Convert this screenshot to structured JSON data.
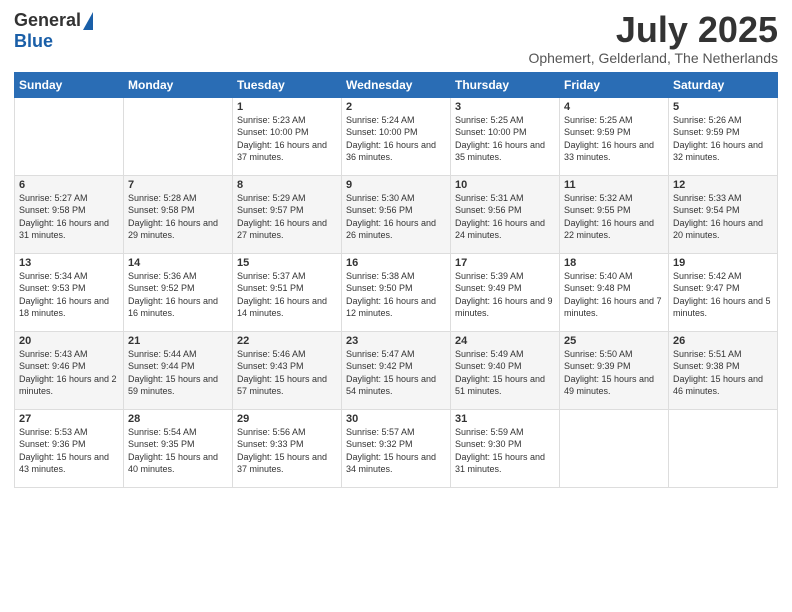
{
  "header": {
    "logo_general": "General",
    "logo_blue": "Blue",
    "month": "July 2025",
    "location": "Ophemert, Gelderland, The Netherlands"
  },
  "weekdays": [
    "Sunday",
    "Monday",
    "Tuesday",
    "Wednesday",
    "Thursday",
    "Friday",
    "Saturday"
  ],
  "weeks": [
    [
      {
        "day": "",
        "sunrise": "",
        "sunset": "",
        "daylight": ""
      },
      {
        "day": "",
        "sunrise": "",
        "sunset": "",
        "daylight": ""
      },
      {
        "day": "1",
        "sunrise": "Sunrise: 5:23 AM",
        "sunset": "Sunset: 10:00 PM",
        "daylight": "Daylight: 16 hours and 37 minutes."
      },
      {
        "day": "2",
        "sunrise": "Sunrise: 5:24 AM",
        "sunset": "Sunset: 10:00 PM",
        "daylight": "Daylight: 16 hours and 36 minutes."
      },
      {
        "day": "3",
        "sunrise": "Sunrise: 5:25 AM",
        "sunset": "Sunset: 10:00 PM",
        "daylight": "Daylight: 16 hours and 35 minutes."
      },
      {
        "day": "4",
        "sunrise": "Sunrise: 5:25 AM",
        "sunset": "Sunset: 9:59 PM",
        "daylight": "Daylight: 16 hours and 33 minutes."
      },
      {
        "day": "5",
        "sunrise": "Sunrise: 5:26 AM",
        "sunset": "Sunset: 9:59 PM",
        "daylight": "Daylight: 16 hours and 32 minutes."
      }
    ],
    [
      {
        "day": "6",
        "sunrise": "Sunrise: 5:27 AM",
        "sunset": "Sunset: 9:58 PM",
        "daylight": "Daylight: 16 hours and 31 minutes."
      },
      {
        "day": "7",
        "sunrise": "Sunrise: 5:28 AM",
        "sunset": "Sunset: 9:58 PM",
        "daylight": "Daylight: 16 hours and 29 minutes."
      },
      {
        "day": "8",
        "sunrise": "Sunrise: 5:29 AM",
        "sunset": "Sunset: 9:57 PM",
        "daylight": "Daylight: 16 hours and 27 minutes."
      },
      {
        "day": "9",
        "sunrise": "Sunrise: 5:30 AM",
        "sunset": "Sunset: 9:56 PM",
        "daylight": "Daylight: 16 hours and 26 minutes."
      },
      {
        "day": "10",
        "sunrise": "Sunrise: 5:31 AM",
        "sunset": "Sunset: 9:56 PM",
        "daylight": "Daylight: 16 hours and 24 minutes."
      },
      {
        "day": "11",
        "sunrise": "Sunrise: 5:32 AM",
        "sunset": "Sunset: 9:55 PM",
        "daylight": "Daylight: 16 hours and 22 minutes."
      },
      {
        "day": "12",
        "sunrise": "Sunrise: 5:33 AM",
        "sunset": "Sunset: 9:54 PM",
        "daylight": "Daylight: 16 hours and 20 minutes."
      }
    ],
    [
      {
        "day": "13",
        "sunrise": "Sunrise: 5:34 AM",
        "sunset": "Sunset: 9:53 PM",
        "daylight": "Daylight: 16 hours and 18 minutes."
      },
      {
        "day": "14",
        "sunrise": "Sunrise: 5:36 AM",
        "sunset": "Sunset: 9:52 PM",
        "daylight": "Daylight: 16 hours and 16 minutes."
      },
      {
        "day": "15",
        "sunrise": "Sunrise: 5:37 AM",
        "sunset": "Sunset: 9:51 PM",
        "daylight": "Daylight: 16 hours and 14 minutes."
      },
      {
        "day": "16",
        "sunrise": "Sunrise: 5:38 AM",
        "sunset": "Sunset: 9:50 PM",
        "daylight": "Daylight: 16 hours and 12 minutes."
      },
      {
        "day": "17",
        "sunrise": "Sunrise: 5:39 AM",
        "sunset": "Sunset: 9:49 PM",
        "daylight": "Daylight: 16 hours and 9 minutes."
      },
      {
        "day": "18",
        "sunrise": "Sunrise: 5:40 AM",
        "sunset": "Sunset: 9:48 PM",
        "daylight": "Daylight: 16 hours and 7 minutes."
      },
      {
        "day": "19",
        "sunrise": "Sunrise: 5:42 AM",
        "sunset": "Sunset: 9:47 PM",
        "daylight": "Daylight: 16 hours and 5 minutes."
      }
    ],
    [
      {
        "day": "20",
        "sunrise": "Sunrise: 5:43 AM",
        "sunset": "Sunset: 9:46 PM",
        "daylight": "Daylight: 16 hours and 2 minutes."
      },
      {
        "day": "21",
        "sunrise": "Sunrise: 5:44 AM",
        "sunset": "Sunset: 9:44 PM",
        "daylight": "Daylight: 15 hours and 59 minutes."
      },
      {
        "day": "22",
        "sunrise": "Sunrise: 5:46 AM",
        "sunset": "Sunset: 9:43 PM",
        "daylight": "Daylight: 15 hours and 57 minutes."
      },
      {
        "day": "23",
        "sunrise": "Sunrise: 5:47 AM",
        "sunset": "Sunset: 9:42 PM",
        "daylight": "Daylight: 15 hours and 54 minutes."
      },
      {
        "day": "24",
        "sunrise": "Sunrise: 5:49 AM",
        "sunset": "Sunset: 9:40 PM",
        "daylight": "Daylight: 15 hours and 51 minutes."
      },
      {
        "day": "25",
        "sunrise": "Sunrise: 5:50 AM",
        "sunset": "Sunset: 9:39 PM",
        "daylight": "Daylight: 15 hours and 49 minutes."
      },
      {
        "day": "26",
        "sunrise": "Sunrise: 5:51 AM",
        "sunset": "Sunset: 9:38 PM",
        "daylight": "Daylight: 15 hours and 46 minutes."
      }
    ],
    [
      {
        "day": "27",
        "sunrise": "Sunrise: 5:53 AM",
        "sunset": "Sunset: 9:36 PM",
        "daylight": "Daylight: 15 hours and 43 minutes."
      },
      {
        "day": "28",
        "sunrise": "Sunrise: 5:54 AM",
        "sunset": "Sunset: 9:35 PM",
        "daylight": "Daylight: 15 hours and 40 minutes."
      },
      {
        "day": "29",
        "sunrise": "Sunrise: 5:56 AM",
        "sunset": "Sunset: 9:33 PM",
        "daylight": "Daylight: 15 hours and 37 minutes."
      },
      {
        "day": "30",
        "sunrise": "Sunrise: 5:57 AM",
        "sunset": "Sunset: 9:32 PM",
        "daylight": "Daylight: 15 hours and 34 minutes."
      },
      {
        "day": "31",
        "sunrise": "Sunrise: 5:59 AM",
        "sunset": "Sunset: 9:30 PM",
        "daylight": "Daylight: 15 hours and 31 minutes."
      },
      {
        "day": "",
        "sunrise": "",
        "sunset": "",
        "daylight": ""
      },
      {
        "day": "",
        "sunrise": "",
        "sunset": "",
        "daylight": ""
      }
    ]
  ]
}
